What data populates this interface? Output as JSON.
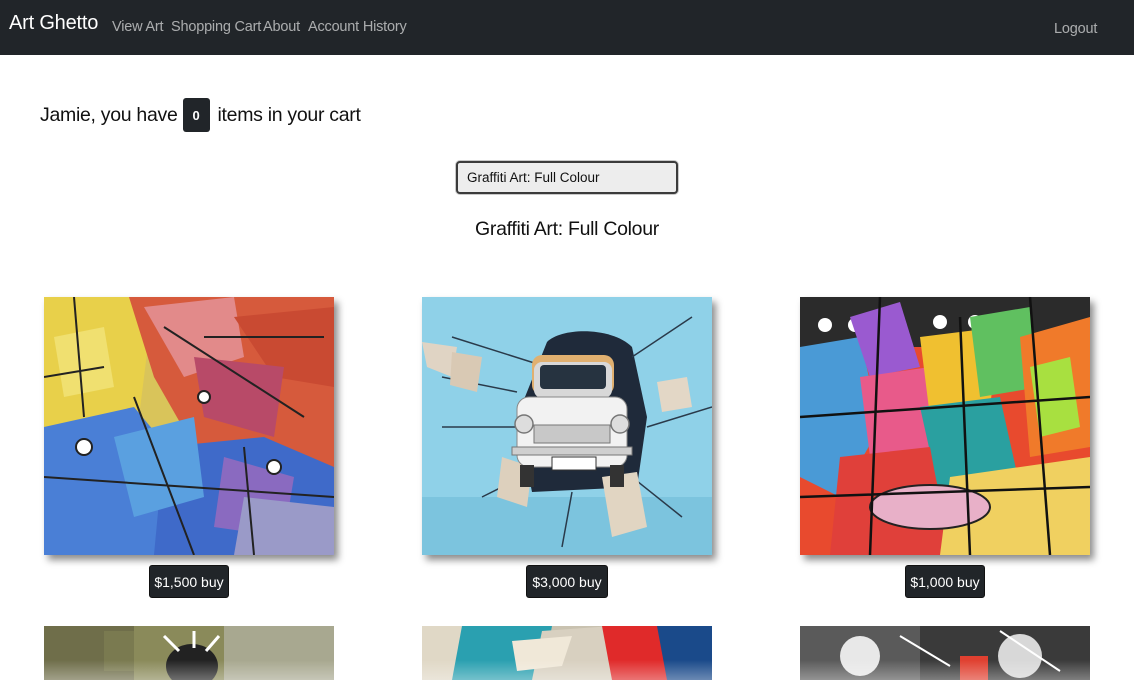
{
  "nav": {
    "brand": "Art Ghetto",
    "links": [
      "View Art",
      "Shopping Cart",
      "About",
      "Account History"
    ],
    "logout": "Logout"
  },
  "cart": {
    "prefix": "Jamie, you have",
    "count": "0",
    "suffix": "items in your cart"
  },
  "category_select": {
    "selected": "Graffiti Art: Full Colour"
  },
  "category_title": "Graffiti Art: Full Colour",
  "artworks": [
    {
      "buy_label": "$1,500 buy"
    },
    {
      "buy_label": "$3,000 buy"
    },
    {
      "buy_label": "$1,000 buy"
    }
  ]
}
